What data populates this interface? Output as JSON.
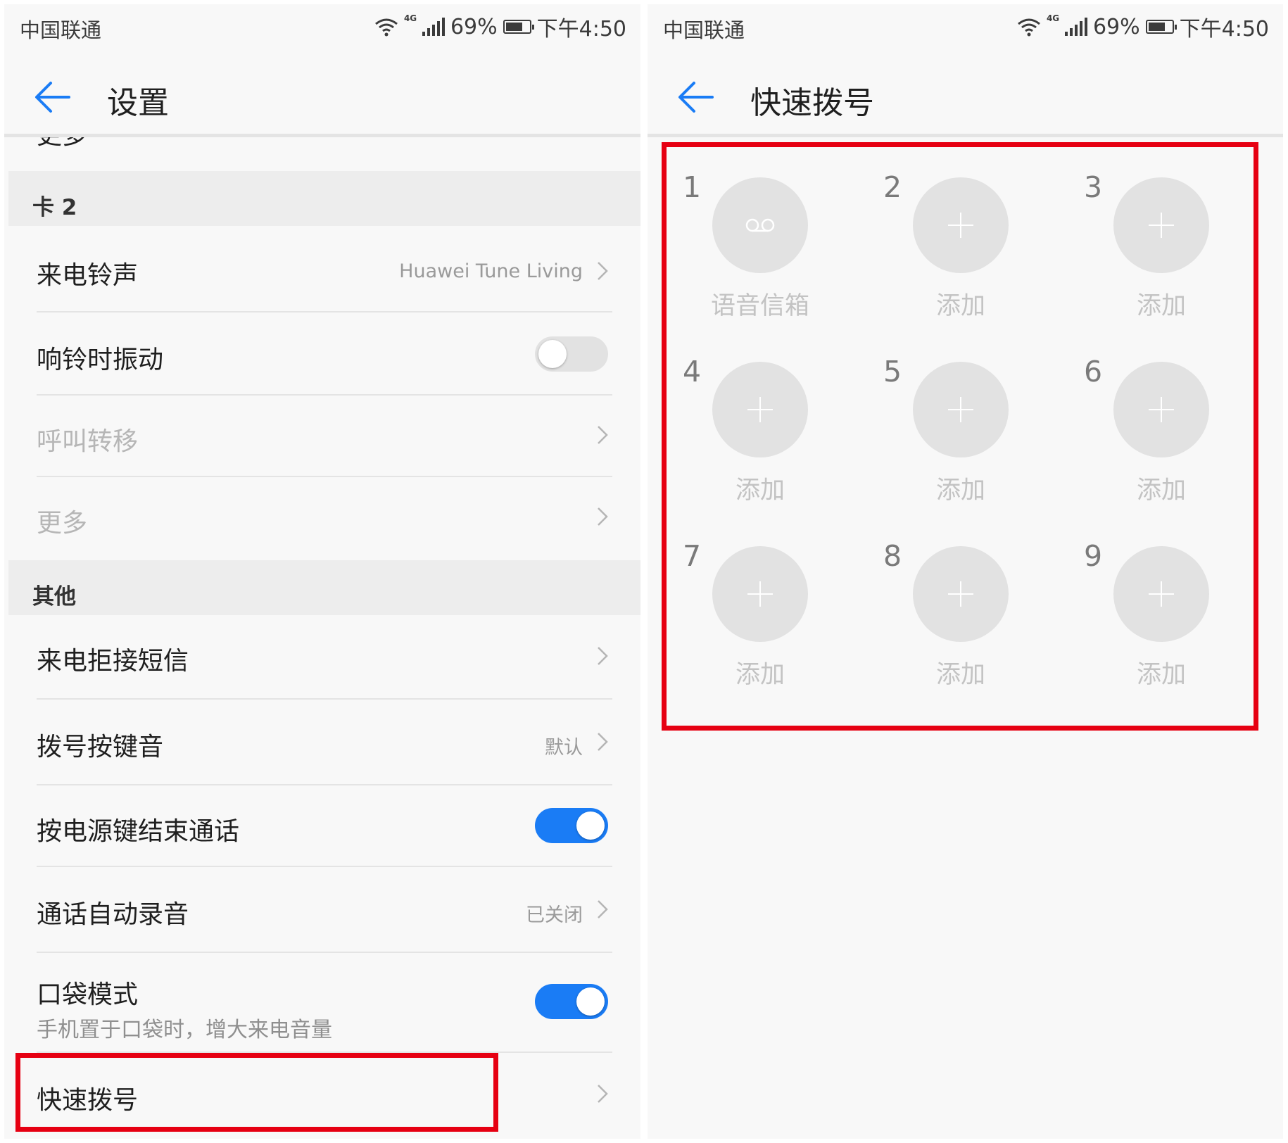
{
  "status_bar": {
    "carrier": "中国联通",
    "network_tag": "4G",
    "battery": "69%",
    "time": "下午4:50"
  },
  "settings": {
    "title": "设置",
    "partial_item": "更多",
    "section_card2": "卡 2",
    "ringtone_label": "来电铃声",
    "ringtone_value": "Huawei Tune Living",
    "vibrate_label": "响铃时振动",
    "vibrate_on": false,
    "forward_label": "呼叫转移",
    "more_label": "更多",
    "section_other": "其他",
    "reject_sms_label": "来电拒接短信",
    "dial_tone_label": "拨号按键音",
    "dial_tone_value": "默认",
    "power_end_label": "按电源键结束通话",
    "power_end_on": true,
    "auto_record_label": "通话自动录音",
    "auto_record_value": "已关闭",
    "pocket_label": "口袋模式",
    "pocket_sub": "手机置于口袋时，增大来电音量",
    "pocket_on": true,
    "speed_dial_label": "快速拨号"
  },
  "speed_dial": {
    "title": "快速拨号",
    "cells": [
      {
        "num": "1",
        "label": "语音信箱",
        "icon": "voicemail-icon"
      },
      {
        "num": "2",
        "label": "添加",
        "icon": "plus-icon"
      },
      {
        "num": "3",
        "label": "添加",
        "icon": "plus-icon"
      },
      {
        "num": "4",
        "label": "添加",
        "icon": "plus-icon"
      },
      {
        "num": "5",
        "label": "添加",
        "icon": "plus-icon"
      },
      {
        "num": "6",
        "label": "添加",
        "icon": "plus-icon"
      },
      {
        "num": "7",
        "label": "添加",
        "icon": "plus-icon"
      },
      {
        "num": "8",
        "label": "添加",
        "icon": "plus-icon"
      },
      {
        "num": "9",
        "label": "添加",
        "icon": "plus-icon"
      }
    ]
  },
  "colors": {
    "accent": "#1a7cf5",
    "highlight": "#e60012",
    "page_bg": "#f8f8f8",
    "section_bg": "#ededed",
    "circle_bg": "#e2e2e2"
  }
}
